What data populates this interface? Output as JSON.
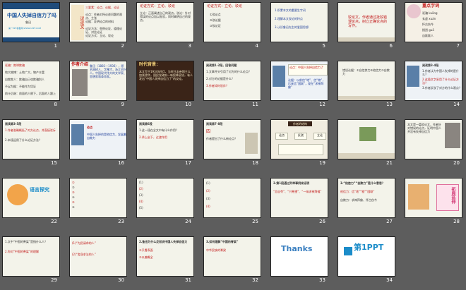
{
  "slides": [
    {
      "num": "1",
      "title": "中国人失掉自信力了吗",
      "author": "鲁迅",
      "footer": "第一PPT模板网-WWW.1PPT.COM"
    },
    {
      "num": "2",
      "rows": [
        "议论文",
        "三要素：论点、论据、论证",
        "论点：作者对所论述问题的观点、主张",
        "论据：证明论点的材料",
        "论证方法：举例论证、道理论证、对比论证",
        "论证方式：立论、驳论"
      ]
    },
    {
      "num": "3",
      "title": "论证方式：立论、驳论",
      "text": "立论：正面阐述自己的观点。驳论：针对错误的论点加以批驳，同时阐明自己的观点。"
    },
    {
      "num": "4",
      "title": "论证方式：立论、驳论",
      "items": [
        "①驳论点",
        "②驳论据",
        "③驳论证"
      ]
    },
    {
      "num": "5",
      "items": [
        "1.积累本文的重要生字词",
        "2.理解本文驳论的特点",
        "3.认识鲁迅先生的爱国思想"
      ]
    },
    {
      "num": "6",
      "text": "驳论文，作者通过批驳错误论点，树立正确论点的写作。"
    },
    {
      "num": "7",
      "title": "重点字词",
      "words": [
        "诓骗 kuāng",
        "玄虚 xuán",
        "怀古伤今",
        "搜刮 guā",
        "自欺欺人"
      ]
    },
    {
      "num": "8",
      "rows": [
        "诓骗：欺哄欺骗",
        "地大物博：土地广大，物产丰富",
        "自欺欺人：欺骗自己也欺骗别人",
        "不足为据：不能作为凭证",
        "前仆后继：前面的人倒下，后面的人跟上"
      ]
    },
    {
      "num": "9",
      "label": "作者介绍",
      "text": "鲁迅（1881—1936），原名周树人，字豫才，浙江绍兴人。中国现代伟大的文学家、思想家和革命家。"
    },
    {
      "num": "10",
      "label": "时代背景：",
      "text": "本文写于1934年9月，当时日本帝国主义加紧侵华，国民党政府一味投降妥协，有人发出“中国人失掉自信力了”的议论。"
    },
    {
      "num": "11",
      "title": "阅读第1-2段，回答问题",
      "items": [
        "1.文章开头引用了对方的什么论点？",
        "2.对方的论据是什么？",
        "3.作者如何驳斥？"
      ]
    },
    {
      "num": "12",
      "text": "论点：中国人失掉自信力了",
      "box": "论据：以前信“地”、信“物”，后来信“国联”，现在“求神拜佛”"
    },
    {
      "num": "13",
      "text": "错误论据：①自信其力②他信力③自欺力"
    },
    {
      "num": "14",
      "title": "阅读第3-4段",
      "items": [
        "1.作者认为中国人失掉的是什么？",
        "2.这段文字采用了什么论证方法？",
        "3.作者反驳了对方的什么观点？"
      ]
    },
    {
      "num": "15",
      "title": "阅读第3-5段",
      "items": [
        "1.作者准确概括了对方论点，并直接驳斥",
        "2.本段运用了什么论证方法？"
      ]
    },
    {
      "num": "16",
      "label": "论点",
      "text": "中国人失掉的是他信力，发展着自欺力"
    },
    {
      "num": "17",
      "title": "阅读第6段",
      "items": [
        "1.这一段在全文中有什么作用？",
        "2.承上启下，过渡作用"
      ]
    },
    {
      "num": "18",
      "title": "阅读第7-8段",
      "items": [
        "四",
        "作者提出了什么新论点？"
      ]
    },
    {
      "num": "19",
      "title": "作者的结构",
      "diagram": [
        "论点",
        "反驳",
        "立论"
      ]
    },
    {
      "num": "20",
      "text": "本文是一篇驳论文，作者针对错误的论点，证明中国人并没有失掉自信力"
    },
    {
      "num": "21",
      "text": "课堂小结"
    },
    {
      "num": "22",
      "badge": "语言探究"
    },
    {
      "num": "23",
      "items": [
        "①",
        "②",
        "③",
        "④",
        "⑤",
        "⑥"
      ]
    },
    {
      "num": "24",
      "items": [
        "(1)",
        "(2)",
        "(3)",
        "(4)",
        "(5)"
      ]
    },
    {
      "num": "25",
      "items": [
        "(1)",
        "(2)",
        "(3)",
        "(4)"
      ]
    },
    {
      "num": "26",
      "title": "2.第1段通过列举事例来证明",
      "text": "“总自夸”、“只希望”、“一味求神拜佛”"
    },
    {
      "num": "27",
      "title": "3.“他信力”“自欺力”是什么意思？",
      "items": [
        "他信力：信“地”“物”“国联”",
        "自欺力：求神拜佛、怀古伤今"
      ]
    },
    {
      "num": "28",
      "badge": "拓展延伸"
    },
    {
      "num": "29",
      "items": [
        "1.文中“中国的脊梁”是指什么人？",
        "2.你对“中国的脊梁”的理解"
      ]
    },
    {
      "num": "30",
      "items": [
        "(1)“为民请命的人”",
        "(2)“舍身求法的人”"
      ]
    },
    {
      "num": "31",
      "items": [
        "2.鲁迅为什么反驳说中国人失掉自信力",
        "①只看表面",
        "②以偏概全"
      ]
    },
    {
      "num": "32",
      "items": [
        "3.如何理解“中国的脊梁”",
        "中华民族的脊梁"
      ]
    },
    {
      "num": "33",
      "badge": "Thanks"
    },
    {
      "num": "34",
      "logo": "第1PPT"
    }
  ],
  "colors": {
    "background": "#5d5d5d",
    "slide": "#f3f3ea",
    "accent": "#c01515",
    "blue": "#1f3f9a",
    "border": "#222222"
  }
}
